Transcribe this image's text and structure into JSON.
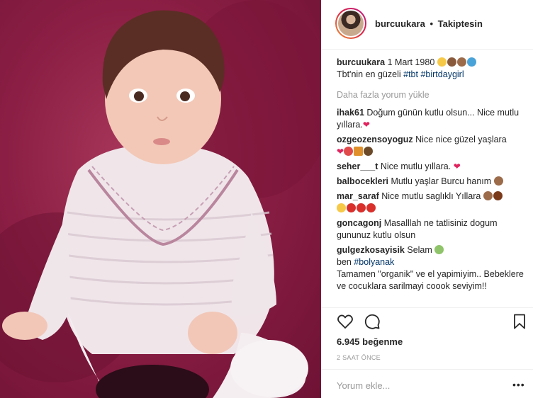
{
  "post": {
    "username": "burcuukara",
    "follow_status": "Takiptesin",
    "separator": "•",
    "caption_user": "burcuukara",
    "caption_text": "1 Mart 1980",
    "caption_line2": "Tbt'nin en güzeli",
    "hashtags": [
      "#tbt",
      "#birtdaygirl"
    ],
    "load_more": "Daha fazla yorum yükle",
    "likes": "6.945 beğenme",
    "time_ago": "2 SAAT ÖNCE",
    "add_comment_placeholder": "Yorum ekle...",
    "more_dots": "•••"
  },
  "comments": [
    {
      "user": "ihak61",
      "text": "Doğum günün kutlu olsun... Nice mutlu yıllara."
    },
    {
      "user": "ozgeozensoyoguz",
      "text": "Nice nice güzel yaşlara"
    },
    {
      "user": "seher___t",
      "text": "Nice mutlu yıllara."
    },
    {
      "user": "balbocekleri",
      "text": "Mutlu yaşlar Burcu hanım"
    },
    {
      "user": "mar_saraf",
      "text": "Nice mutlu saglıklı Yıllara"
    },
    {
      "user": "goncagonj",
      "text": "Masalllah ne tatlisiniz dogum gununuz kutlu olsun"
    },
    {
      "user": "gulgezkosayisik",
      "text": "Selam",
      "extra_pre": "ben",
      "extra_tag": "#bolyanak",
      "extra_post": "Tamamen \"organik\" ve el yapimiyim.. Bebeklere ve cocuklara sarilmayi coook seviyim!!"
    }
  ],
  "icons": [
    "heart-icon",
    "comment-icon",
    "bookmark-icon"
  ],
  "colors": {
    "link": "#003569",
    "muted": "#999999",
    "heart": "#e0245e",
    "photo_bg": "#8b1e44"
  }
}
